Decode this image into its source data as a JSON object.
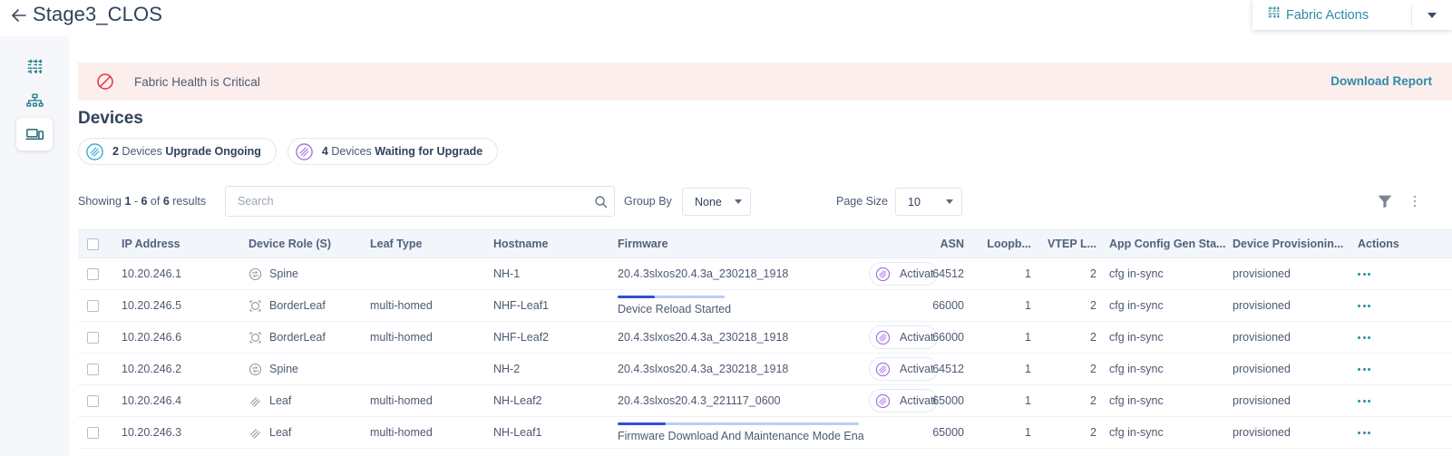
{
  "header": {
    "back_icon": "arrow-left-icon",
    "title": "Stage3_CLOS",
    "fabric_actions": {
      "icon": "fabric-grid-icon",
      "label": "Fabric Actions",
      "caret_icon": "chevron-down-icon"
    }
  },
  "sidebar": {
    "items": [
      {
        "name": "fabric-grid",
        "icon": "fabric-grid-icon",
        "selected": false
      },
      {
        "name": "topology",
        "icon": "topology-icon",
        "selected": false
      },
      {
        "name": "devices",
        "icon": "devices-icon",
        "selected": true
      }
    ]
  },
  "banner": {
    "icon": "critical-icon",
    "text": "Fabric Health is Critical",
    "link_label": "Download Report",
    "bg_color": "#fdeeee",
    "icon_color": "#e0343f",
    "link_color": "#2e8aa5"
  },
  "section": {
    "title": "Devices",
    "chips": [
      {
        "icon": "upgrade-ongoing-icon",
        "count": "2",
        "text_mid": " Devices ",
        "text_bold": "Upgrade Ongoing",
        "color": "#29a8d0"
      },
      {
        "icon": "waiting-upgrade-icon",
        "count": "4",
        "text_mid": " Devices ",
        "text_bold": "Waiting for Upgrade",
        "color": "#a06fd8"
      }
    ]
  },
  "toolbar": {
    "showing_prefix": "Showing ",
    "showing_from": "1",
    "showing_dash": " - ",
    "showing_to": "6",
    "showing_of": " of ",
    "showing_total": "6",
    "showing_suffix": " results",
    "search_placeholder": "Search",
    "search_value": "",
    "search_icon": "search-icon",
    "group_by_label": "Group By",
    "group_by_value": "None",
    "page_size_label": "Page Size",
    "page_size_value": "10",
    "filter_icon": "funnel-icon",
    "more_icon": "kebab-icon"
  },
  "table": {
    "columns": [
      "IP Address",
      "Device Role (S)",
      "Leaf Type",
      "Hostname",
      "Firmware",
      "ASN",
      "Loopb...",
      "VTEP L...",
      "App Config Gen Sta...",
      "Device Provisionin...",
      "Actions"
    ],
    "rows": [
      {
        "ip": "10.20.246.1",
        "role": "Spine",
        "role_icon": "spine-icon",
        "leaf_type": "",
        "hostname": "NH-1",
        "firmware_type": "text",
        "firmware": "20.4.3slxos20.4.3a_230218_1918",
        "badge": "Activat",
        "badge_icon": "activating-icon",
        "asn": "64512",
        "loopback": "1",
        "vtep": "2",
        "app_config": "cfg in-sync",
        "provisioning": "provisioned",
        "actions_icon": "kebab-icon"
      },
      {
        "ip": "10.20.246.5",
        "role": "BorderLeaf",
        "role_icon": "borderleaf-icon",
        "leaf_type": "multi-homed",
        "hostname": "NHF-Leaf1",
        "firmware_type": "progress",
        "firmware": "Device Reload Started",
        "progress_percent": 35,
        "progress_track_width": 118,
        "badge": "",
        "badge_icon": "",
        "asn": "66000",
        "loopback": "1",
        "vtep": "2",
        "app_config": "cfg in-sync",
        "provisioning": "provisioned",
        "actions_icon": "kebab-icon"
      },
      {
        "ip": "10.20.246.6",
        "role": "BorderLeaf",
        "role_icon": "borderleaf-icon",
        "leaf_type": "multi-homed",
        "hostname": "NHF-Leaf2",
        "firmware_type": "text",
        "firmware": "20.4.3slxos20.4.3a_230218_1918",
        "badge": "Activat",
        "badge_icon": "activating-icon",
        "asn": "66000",
        "loopback": "1",
        "vtep": "2",
        "app_config": "cfg in-sync",
        "provisioning": "provisioned",
        "actions_icon": "kebab-icon"
      },
      {
        "ip": "10.20.246.2",
        "role": "Spine",
        "role_icon": "spine-icon",
        "leaf_type": "",
        "hostname": "NH-2",
        "firmware_type": "text",
        "firmware": "20.4.3slxos20.4.3a_230218_1918",
        "badge": "Activat",
        "badge_icon": "activating-icon",
        "asn": "64512",
        "loopback": "1",
        "vtep": "2",
        "app_config": "cfg in-sync",
        "provisioning": "provisioned",
        "actions_icon": "kebab-icon"
      },
      {
        "ip": "10.20.246.4",
        "role": "Leaf",
        "role_icon": "leaf-icon",
        "leaf_type": "multi-homed",
        "hostname": "NH-Leaf2",
        "firmware_type": "text",
        "firmware": "20.4.3slxos20.4.3_221117_0600",
        "badge": "Activatio",
        "badge_icon": "activating-icon",
        "asn": "65000",
        "loopback": "1",
        "vtep": "2",
        "app_config": "cfg in-sync",
        "provisioning": "provisioned",
        "actions_icon": "kebab-icon"
      },
      {
        "ip": "10.20.246.3",
        "role": "Leaf",
        "role_icon": "leaf-icon",
        "leaf_type": "multi-homed",
        "hostname": "NH-Leaf1",
        "firmware_type": "progress",
        "firmware": "Firmware Download And Maintenance Mode Ena",
        "progress_percent": 20,
        "progress_track_width": 266,
        "badge": "",
        "badge_icon": "",
        "asn": "65000",
        "loopback": "1",
        "vtep": "2",
        "app_config": "cfg in-sync",
        "provisioning": "provisioned",
        "actions_icon": "kebab-icon"
      }
    ]
  }
}
